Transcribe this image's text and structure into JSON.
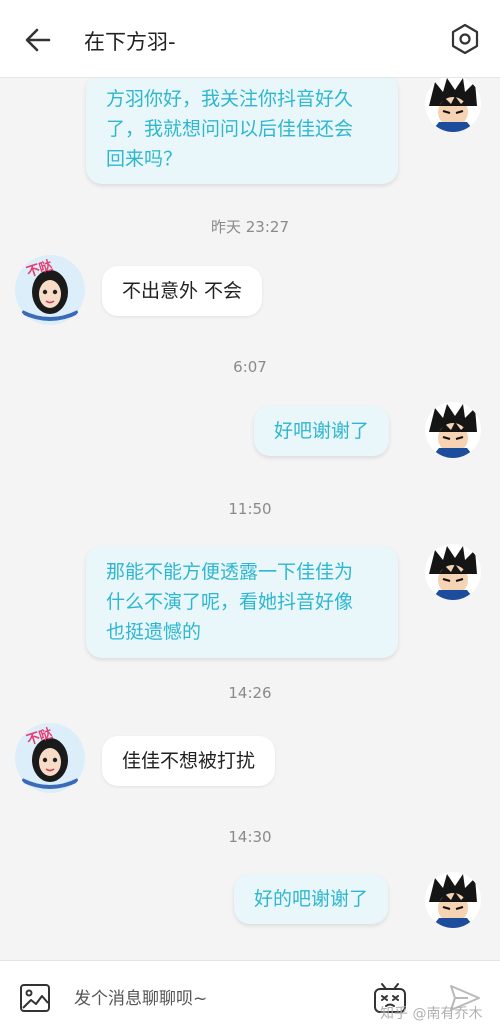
{
  "header": {
    "title": "在下方羽-",
    "back_icon": "arrow-left-icon",
    "settings_icon": "hexagon-settings-icon"
  },
  "messages": [
    {
      "side": "me",
      "text_lines": [
        "方羽你好，我关注你抖音好久",
        "了，我就想问问以后佳佳还会",
        "回来吗？"
      ]
    },
    {
      "timestamp": "昨天 23:27"
    },
    {
      "side": "them",
      "text": "不出意外 不会"
    },
    {
      "timestamp": "6:07"
    },
    {
      "side": "me",
      "text": "好吧谢谢了"
    },
    {
      "timestamp": "11:50"
    },
    {
      "side": "me",
      "text_lines": [
        "那能不能方便透露一下佳佳为",
        "什么不演了呢，看她抖音好像",
        "也挺遗憾的"
      ]
    },
    {
      "timestamp": "14:26"
    },
    {
      "side": "them",
      "text": "佳佳不想被打扰"
    },
    {
      "timestamp": "14:30"
    },
    {
      "side": "me",
      "text": "好的吧谢谢了"
    }
  ],
  "avatars": {
    "them_badge_text": "不哒",
    "me_icon": "anime-boy-avatar",
    "them_icon": "anime-girl-avatar"
  },
  "footer": {
    "placeholder": "发个消息聊聊呗~",
    "image_icon": "image-icon",
    "emoji_icon": "emoji-icon",
    "send_icon": "send-icon",
    "watermark": "知乎 @南有乔木"
  },
  "colors": {
    "my_bubble_bg": "#e9f7fb",
    "my_bubble_text": "#2fb7cf",
    "their_bubble_bg": "#ffffff",
    "timestamp": "#8a8a8a",
    "background": "#f4f4f4"
  }
}
